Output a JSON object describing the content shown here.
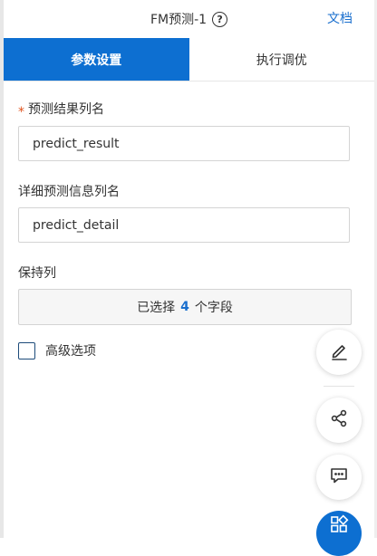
{
  "header": {
    "title": "FM预测-1",
    "help_glyph": "?",
    "doc_link": "文档"
  },
  "tabs": [
    {
      "label": "参数设置",
      "active": true
    },
    {
      "label": "执行调优",
      "active": false
    }
  ],
  "form": {
    "result_column": {
      "label": "预测结果列名",
      "required_mark": "*",
      "value": "predict_result"
    },
    "detail_column": {
      "label": "详细预测信息列名",
      "value": "predict_detail"
    },
    "keep_columns": {
      "label": "保持列",
      "prefix": "已选择",
      "count": "4",
      "suffix": "个字段"
    },
    "advanced": {
      "label": "高级选项",
      "checked": false
    }
  },
  "floating_actions": [
    {
      "icon": "edit-icon"
    },
    {
      "icon": "share-icon"
    },
    {
      "icon": "comment-icon"
    },
    {
      "icon": "apps-icon"
    }
  ],
  "colors": {
    "accent": "#0d6fd1",
    "link": "#1a6fce",
    "required": "#e0541f"
  }
}
